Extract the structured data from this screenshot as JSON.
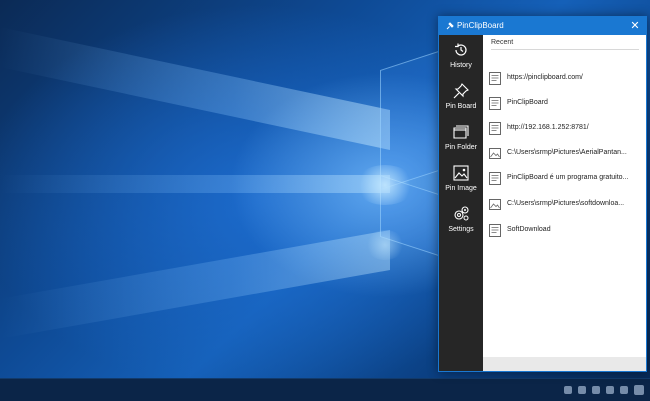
{
  "window": {
    "title": "PinClipBoard",
    "close_glyph": "✕"
  },
  "sidebar": {
    "items": [
      {
        "label": "History",
        "icon": "history-icon"
      },
      {
        "label": "Pin Board",
        "icon": "pin-icon"
      },
      {
        "label": "Pin Folder",
        "icon": "folder-icon"
      },
      {
        "label": "Pin Image",
        "icon": "image-icon"
      },
      {
        "label": "Settings",
        "icon": "gear-icon"
      }
    ]
  },
  "main": {
    "section_title": "Recent",
    "items": [
      {
        "type": "text",
        "icon": "text-document-icon",
        "text": "https://pinclipboard.com/"
      },
      {
        "type": "text",
        "icon": "text-document-icon",
        "text": "PinClipBoard"
      },
      {
        "type": "text",
        "icon": "text-document-icon",
        "text": "http://192.168.1.252:8781/"
      },
      {
        "type": "image",
        "icon": "image-file-icon",
        "text": "C:\\Users\\srmp\\Pictures\\AerialPantan..."
      },
      {
        "type": "text",
        "icon": "text-document-icon",
        "text": "PinClipBoard é um programa gratuito..."
      },
      {
        "type": "image",
        "icon": "image-file-icon",
        "text": "C:\\Users\\srmp\\Pictures\\softdownloa..."
      },
      {
        "type": "text",
        "icon": "text-document-icon",
        "text": "SoftDownload"
      }
    ]
  },
  "colors": {
    "accent": "#1a78d2",
    "sidebar_bg": "#262626",
    "taskbar_bg": "#0b2548"
  }
}
